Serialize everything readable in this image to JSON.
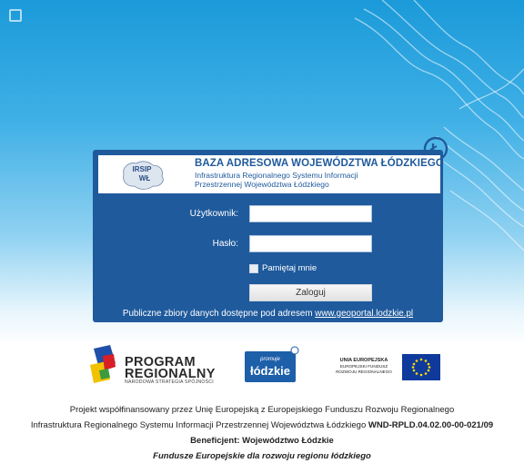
{
  "header": {
    "title": "BAZA ADRESOWA WOJEWÓDZTWA ŁÓDZKIEGO",
    "subtitle_line1": "Infrastruktura Regionalnego Systemu Informacji",
    "subtitle_line2": "Przestrzennej Województwa Łódzkiego",
    "emblem_text": "IRSIP WŁ"
  },
  "login": {
    "user_label": "Użytkownik:",
    "user_value": "",
    "password_label": "Hasło:",
    "password_value": "",
    "remember_label": "Pamiętaj mnie",
    "remember_checked": false,
    "submit_label": "Zaloguj"
  },
  "public_info": {
    "text": "Publiczne zbiory danych dostępne pod adresem",
    "link_text": "www.geoportal.lodzkie.pl"
  },
  "logos": {
    "program_line1": "PROGRAM",
    "program_line2": "REGIONALNY",
    "program_line3": "NARODOWA STRATEGIA SPÓJNOŚCI",
    "lodzkie_small": "promuje",
    "lodzkie_big": "łódzkie",
    "ue_line1": "UNIA EUROPEJSKA",
    "ue_line2": "EUROPEJSKI FUNDUSZ",
    "ue_line3": "ROZWOJU REGIONALNEGO"
  },
  "footer": {
    "line1": "Projekt współfinansowany przez Unię Europejską z Europejskiego Funduszu Rozwoju Regionalnego",
    "line2": "Infrastruktura Regionalnego Systemu Informacji Przestrzennej Województwa Łódzkiego",
    "line2_code": "WND-RPLD.04.02.00-00-021/09",
    "line3": "Beneficjent: Województwo Łódzkie",
    "line4": "Fundusze Europejskie dla rozwoju regionu łódzkiego"
  },
  "colors": {
    "panel": "#1f5a9c",
    "sky_top": "#1b9ad9",
    "eu_flag": "#0f3a9c",
    "eu_star": "#ffdd00"
  }
}
